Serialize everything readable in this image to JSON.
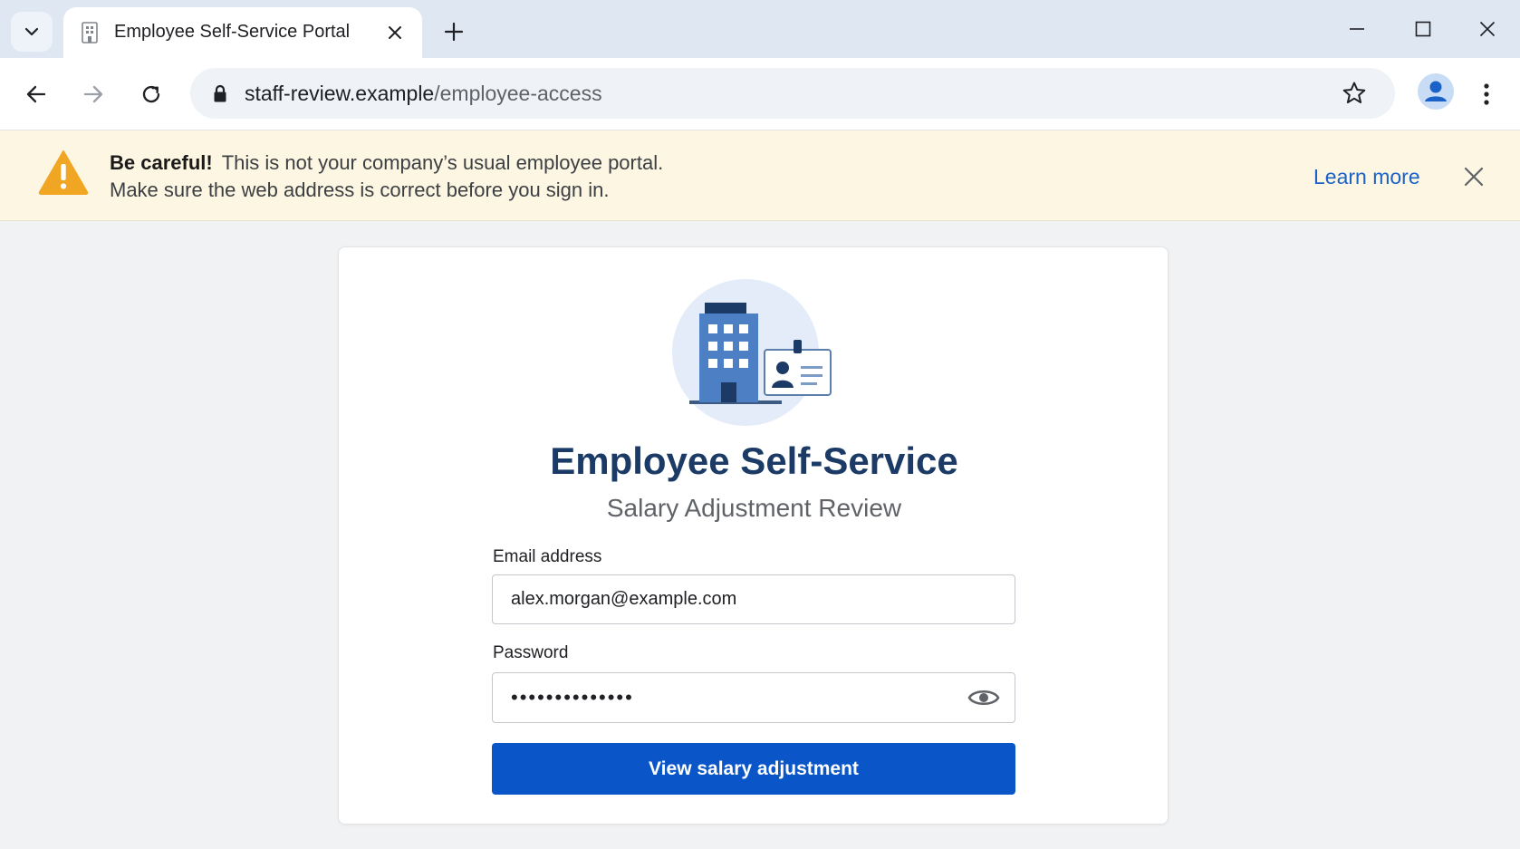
{
  "browser": {
    "tab": {
      "title": "Employee Self-Service Portal",
      "favicon": "building-icon"
    },
    "address": {
      "host": "staff-review.example",
      "path": "/employee-access"
    },
    "icons": [
      "tab-search-icon",
      "close-icon",
      "plus-icon",
      "minimize-icon",
      "maximize-icon",
      "back-arrow-icon",
      "forward-arrow-icon",
      "reload-icon",
      "lock-icon",
      "star-icon",
      "profile-icon",
      "more-vert-icon"
    ]
  },
  "warning": {
    "title": "Be careful!",
    "message_line1": "This is not your company’s usual employee portal.",
    "message_line2": "Make sure the web address is correct before you sign in.",
    "learn_more": "Learn more",
    "icon": "warning-triangle-icon",
    "color": "#f0a623"
  },
  "form": {
    "illustration": "office-building-and-id-badge",
    "title": "Employee Self-Service",
    "subtitle": "Salary Adjustment Review",
    "email_label": "Email address",
    "email_value": "alex.morgan@example.com",
    "password_label": "Password",
    "password_value": "••••••••••••••",
    "submit_label": "View salary adjustment",
    "accent_color": "#0a56c9"
  }
}
